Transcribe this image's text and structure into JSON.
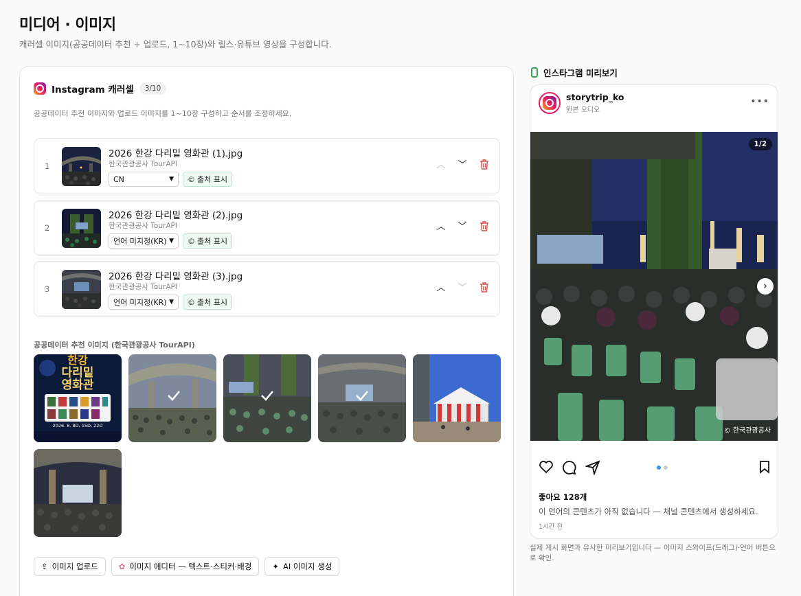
{
  "page": {
    "title": "미디어 · 이미지",
    "subtitle": "캐러셀 이미지(공공데이터 추천 + 업로드, 1~10장)와 릴스·유튜브 영상을 구성합니다."
  },
  "carousel": {
    "title": "Instagram 캐러셀",
    "count": "3/10",
    "description": "공공데이터 추천 이미지와 업로드 이미지를 1~10장 구성하고 순서를 조정하세요.",
    "items": [
      {
        "num": "1",
        "name": "2026 한강 다리밑 영화관 (1).jpg",
        "source": "한국관광공사 TourAPI",
        "lang": "CN",
        "credit": "출처 표시"
      },
      {
        "num": "2",
        "name": "2026 한강 다리밑 영화관 (2).jpg",
        "source": "한국관광공사 TourAPI",
        "lang": "언어 미지정(KR)",
        "credit": "출처 표시"
      },
      {
        "num": "3",
        "name": "2026 한강 다리밑 영화관 (3).jpg",
        "source": "한국관광공사 TourAPI",
        "lang": "언어 미지정(KR)",
        "credit": "출처 표시"
      }
    ],
    "recommended_label": "공공데이터 추천 이미지 (한국관광공사 TourAPI)",
    "poster_text": {
      "line1": "한강",
      "line2": "다리밑",
      "line3": "영화관",
      "date": "2026. 8. 8D, 15D, 22D"
    },
    "buttons": {
      "upload": "이미지 업로드",
      "editor": "이미지 에디터 — 텍스트·스티커·배경",
      "ai": "AI 이미지 생성"
    }
  },
  "preview": {
    "heading": "인스타그램 미리보기",
    "username": "storytrip_ko",
    "audio": "원본 오디오",
    "page_indicator": "1/2",
    "photo_credit": "© 한국관광공사",
    "likes": "좋아요 128개",
    "caption": "이 언어의 콘텐츠가 아직 없습니다 — 채널 콘텐츠에서 생성하세요.",
    "time": "1시간 전",
    "note": "실제 게시 화면과 유사한 미리보기입니다 — 이미지 스와이프(드래그)·언어 버튼으로 확인."
  },
  "colors": {
    "delete": "#d9534f",
    "credit_bg": "#eefaf3",
    "dot_active": "#3897f0",
    "phone_icon": "#3ca35c"
  }
}
